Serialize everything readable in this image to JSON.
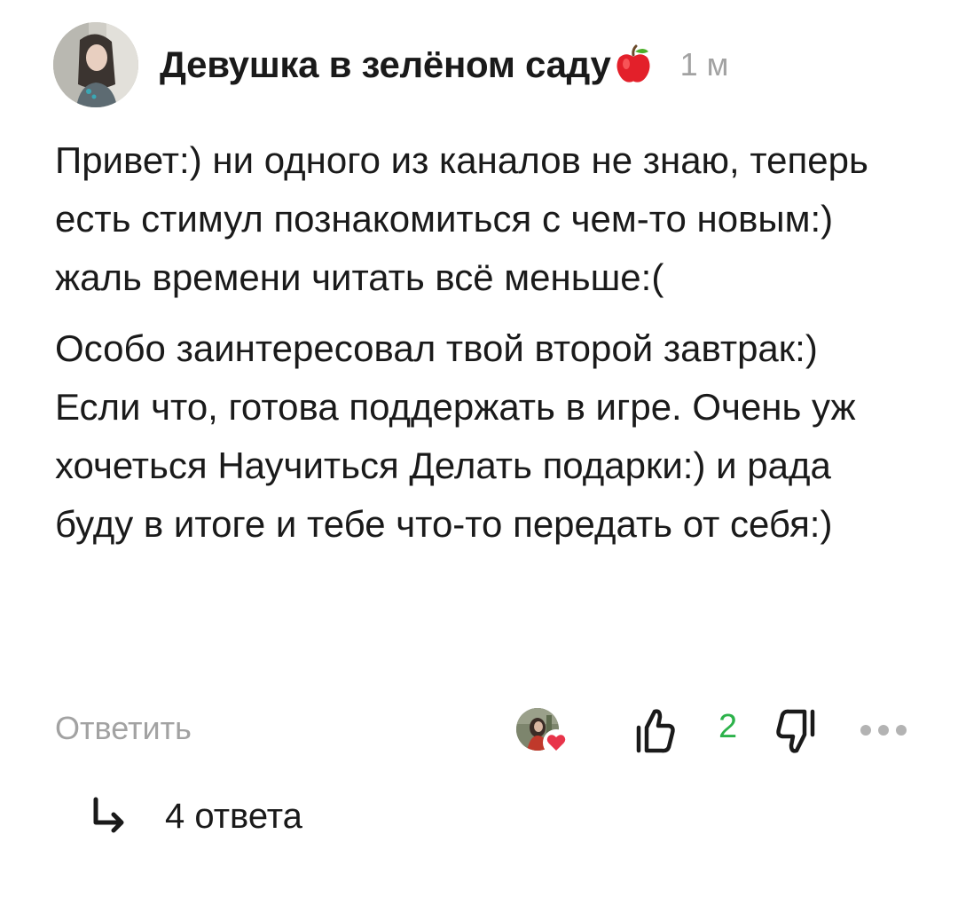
{
  "comment": {
    "author": "Девушка в зелёном саду",
    "author_emoji": "apple-emoji",
    "time": "1 м",
    "paragraphs": [
      "Привет:) ни одного из каналов не знаю, теперь есть стимул познакомиться с чем-то новым:) жаль времени читать всё меньше:(",
      "Особо заинтересовал твой второй завтрак:) Если что, готова поддержать в игре. Очень уж хочеться Научиться Делать подарки:) и рада буду в итоге и тебе что-то передать от себя:)"
    ]
  },
  "actions": {
    "reply_label": "Ответить",
    "like_count": "2",
    "icons": [
      "liker-avatar-with-heart",
      "thumbs-up-icon",
      "thumbs-down-icon",
      "more-dots-icon"
    ]
  },
  "replies": {
    "label": "4 ответа",
    "icon": "reply-arrow-icon"
  },
  "colors": {
    "text": "#1a1a1a",
    "muted": "#a2a2a2",
    "like_count": "#2cb24a",
    "heart": "#e8344a"
  }
}
